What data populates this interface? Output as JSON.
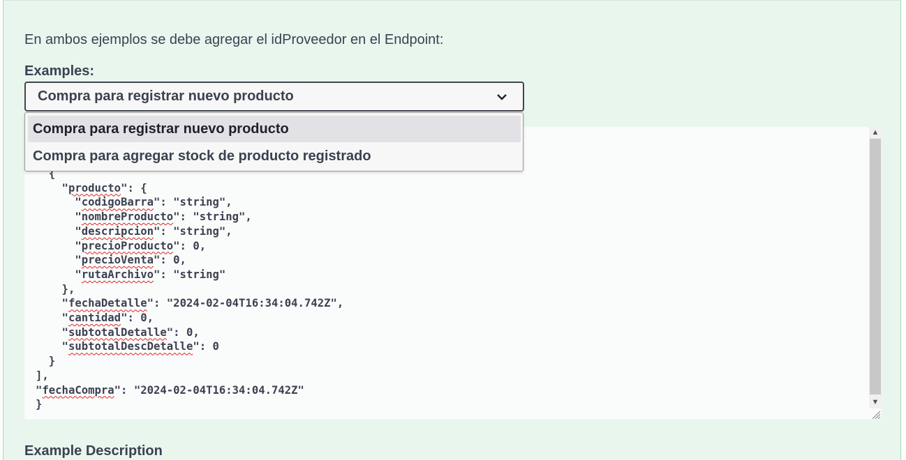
{
  "description": "En ambos ejemplos se debe agregar el idProveedor en el Endpoint:",
  "examples": {
    "label": "Examples:",
    "selected": "Compra para registrar nuevo producto",
    "options": [
      "Compra para registrar nuevo producto",
      "Compra para agregar stock de producto registrado"
    ]
  },
  "code_lines": [
    "  {",
    "    \"producto\": {",
    "      \"codigoBarra\": \"string\",",
    "      \"nombreProducto\": \"string\",",
    "      \"descripcion\": \"string\",",
    "      \"precioProducto\": 0,",
    "      \"precioVenta\": 0,",
    "      \"rutaArchivo\": \"string\"",
    "    },",
    "    \"fechaDetalle\": \"2024-02-04T16:34:04.742Z\",",
    "    \"cantidad\": 0,",
    "    \"subtotalDetalle\": 0,",
    "    \"subtotalDescDetalle\": 0",
    "  }",
    "],",
    "\"fechaCompra\": \"2024-02-04T16:34:04.742Z\"",
    "}"
  ],
  "next_heading": "Example Description",
  "colors": {
    "panel_bg": "#e8f6ee",
    "text": "#3b4151",
    "spellcheck": "#dd2222"
  },
  "icons": [
    "chevron-down-icon",
    "scroll-up-icon",
    "scroll-down-icon",
    "resize-handle-icon"
  ]
}
